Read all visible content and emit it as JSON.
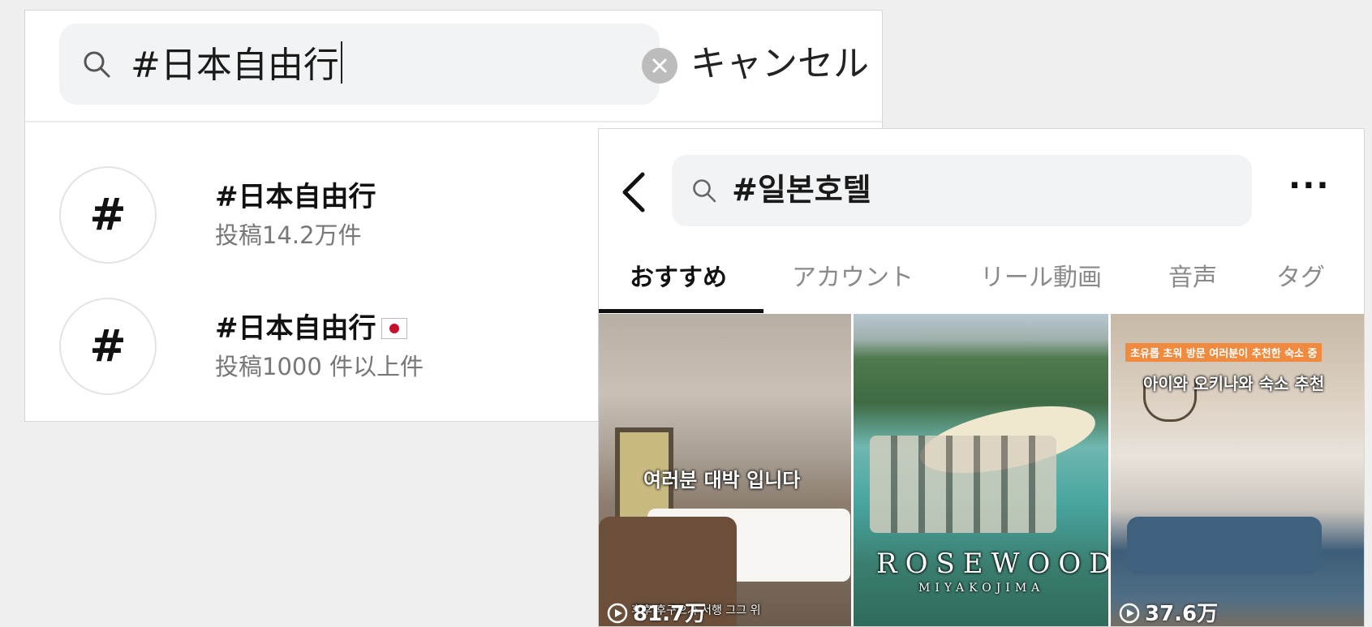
{
  "japanese_search": {
    "query": "#日本自由行",
    "cancel_label": "キャンセル",
    "results": [
      {
        "icon": "#",
        "title": "#日本自由行",
        "subtitle": "投稿14.2万件",
        "has_flag": false
      },
      {
        "icon": "#",
        "title": "#日本自由行",
        "subtitle": "投稿1000 件以上件",
        "has_flag": true
      }
    ]
  },
  "korean_results": {
    "query": "#일본호텔",
    "more_label": "···",
    "tabs": [
      "おすすめ",
      "アカウント",
      "リール動画",
      "音声",
      "タグ"
    ],
    "active_tab": "おすすめ",
    "thumbnails": [
      {
        "caption": "여러분 대박 입니다",
        "small_caption": "후후 후구으가 서행 그그 위",
        "views": "81.7万"
      },
      {
        "brand": "ROSEWOOD",
        "brand_sub": "MIYAKOJIMA",
        "views": ""
      },
      {
        "banner": "초유롭 초워 방문 여러분이 추천한 숙소 중",
        "caption": "아이와 오키나와 숙소 추천",
        "views": "37.6万"
      }
    ]
  },
  "colors": {
    "search_bg": "#f1f3f5",
    "flag_red": "#c8102e",
    "muted_text": "#777777"
  }
}
